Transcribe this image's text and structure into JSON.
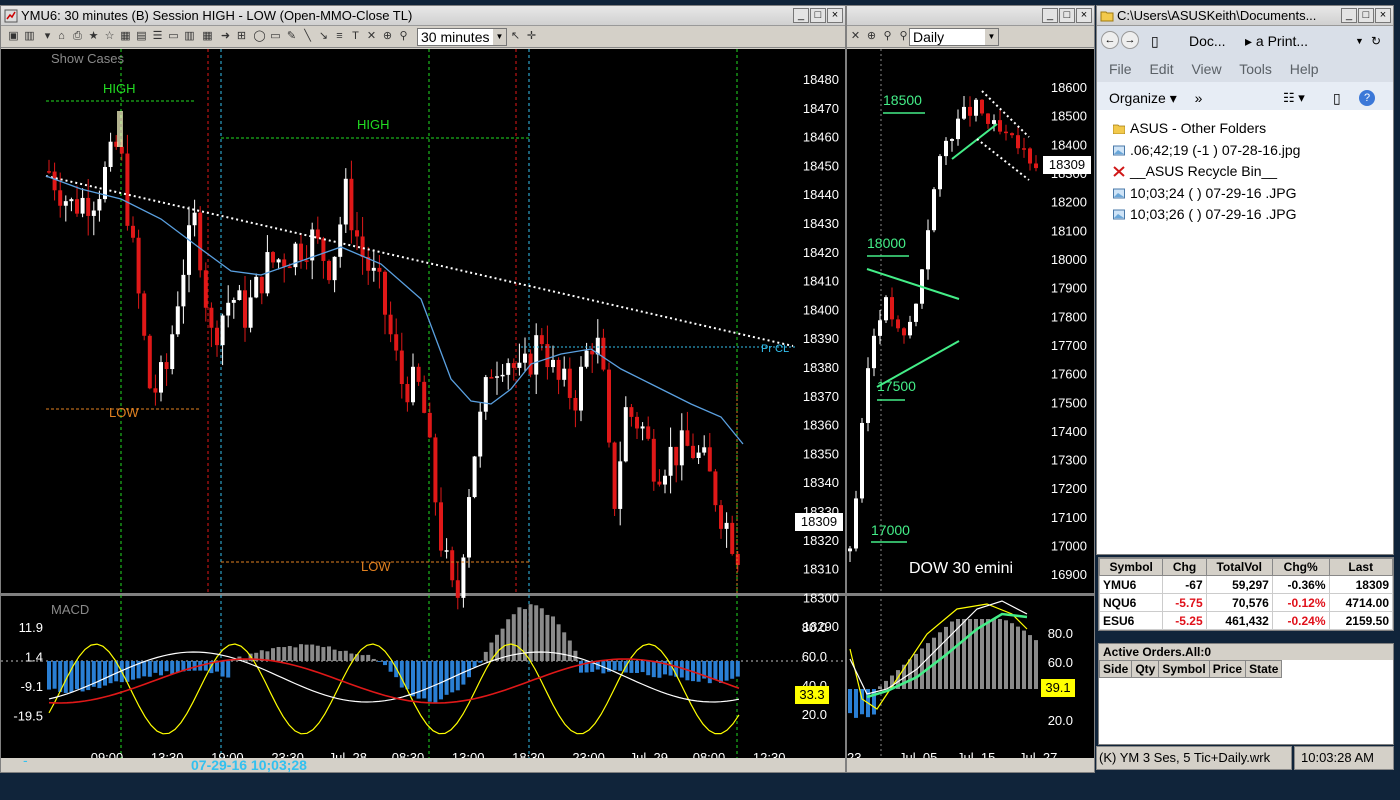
{
  "intraday": {
    "title": "YMU6: 30 minutes (B) Session HIGH - LOW (Open-MMO-Close TL)",
    "interval": "30 minutes",
    "show_cases": "Show Cases",
    "high1": "HIGH",
    "low1": "LOW",
    "high2": "HIGH",
    "low2": "LOW",
    "pr_cl": "Pr CL",
    "price_ticks": [
      "18480",
      "18470",
      "18460",
      "18450",
      "18440",
      "18430",
      "18420",
      "18410",
      "18400",
      "18390",
      "18380",
      "18370",
      "18360",
      "18350",
      "18340",
      "18330",
      "18320",
      "18310",
      "18300",
      "18290"
    ],
    "last_price": "18309",
    "macd_label": "MACD",
    "macd_left_ticks": [
      "11.9",
      "1.4",
      "-9.1",
      "-19.5"
    ],
    "macd_right_ticks": [
      "80.0",
      "60.0",
      "40.0",
      "20.0"
    ],
    "macd_value": "33.3",
    "time_ticks": [
      "09:00",
      "13:30",
      "19:00",
      "23:30",
      "Jul, 28",
      "08:30",
      "13:00",
      "18:30",
      "23:00",
      "Jul, 29",
      "08:00",
      "12:30"
    ],
    "watermark": "07-29-16  10;03;28"
  },
  "daily": {
    "interval": "Daily",
    "labels": [
      "18500",
      "18000",
      "17500",
      "17000"
    ],
    "caption": "DOW 30 emini",
    "price_ticks": [
      "18600",
      "18500",
      "18400",
      "18300",
      "18200",
      "18100",
      "18000",
      "17900",
      "17800",
      "17700",
      "17600",
      "17500",
      "17400",
      "17300",
      "17200",
      "17100",
      "17000",
      "16900"
    ],
    "last_price": "18309",
    "macd_right_ticks": [
      "80.0",
      "60.0",
      "40.0",
      "20.0"
    ],
    "macd_value": "39.1",
    "time_ticks": [
      "23",
      "Jul, 05",
      "Jul, 15",
      "Jul, 27"
    ]
  },
  "explorer": {
    "title": "C:\\Users\\ASUSKeith\\Documents...",
    "path1": "Doc...",
    "path2": "a Print...",
    "menu": [
      "File",
      "Edit",
      "View",
      "Tools",
      "Help"
    ],
    "organize": "Organize",
    "more": "»",
    "files": [
      {
        "name": "ASUS - Other Folders",
        "icon": "folder-icon"
      },
      {
        "name": ".06;42;19 (-1 ) 07-28-16.jpg",
        "icon": "image-icon"
      },
      {
        "name": "__ASUS Recycle Bin__",
        "icon": "recycle-bin-icon"
      },
      {
        "name": "10;03;24 ( ) 07-29-16 .JPG",
        "icon": "image-icon"
      },
      {
        "name": "10;03;26 ( ) 07-29-16 .JPG",
        "icon": "image-icon"
      }
    ]
  },
  "quotes": {
    "headers": [
      "Symbol",
      "Chg",
      "TotalVol",
      "Chg%",
      "Last"
    ],
    "rows": [
      {
        "symbol": "YMU6",
        "chg": "-67",
        "vol": "59,297",
        "pct": "-0.36%",
        "last": "18309"
      },
      {
        "symbol": "NQU6",
        "chg": "-5.75",
        "vol": "70,576",
        "pct": "-0.12%",
        "last": "4714.00"
      },
      {
        "symbol": "ESU6",
        "chg": "-5.25",
        "vol": "461,432",
        "pct": "-0.24%",
        "last": "2159.50"
      }
    ]
  },
  "orders": {
    "title": "Active Orders.All:0",
    "headers": [
      "Side",
      "Qty",
      "Symbol",
      "Price",
      "State"
    ]
  },
  "status": {
    "workspace": "(K) YM 3 Ses, 5 Tic+Daily.wrk",
    "time": "10:03:28 AM"
  },
  "colors": {
    "up": "#ffffff",
    "down": "#e01818",
    "macd_bar": "#2a7fd4",
    "macd_bar_gray": "#8a8a8a",
    "green": "#22dd22",
    "cyan": "#33c0ee",
    "yellow": "#ffff00"
  }
}
